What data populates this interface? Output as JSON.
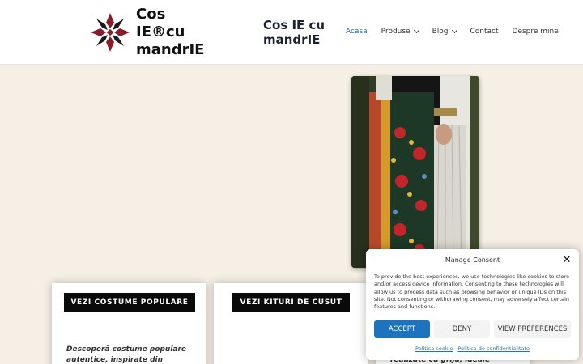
{
  "header": {
    "logo_text": "Cos IE®cu mandrIE",
    "logo_line1": "Cos IE®cu",
    "logo_line2": "mandrIE",
    "site_title_line1": "Cos IE cu",
    "site_title_line2": "mandrIE",
    "nav": [
      {
        "label": "Acasa",
        "active": true,
        "dropdown": false
      },
      {
        "label": "Produse",
        "active": false,
        "dropdown": true
      },
      {
        "label": "Blog",
        "active": false,
        "dropdown": true
      },
      {
        "label": "Contact",
        "active": false,
        "dropdown": false
      },
      {
        "label": "Despre mine",
        "active": false,
        "dropdown": false
      }
    ]
  },
  "cards": [
    {
      "button": "VEZI COSTUME POPULARE",
      "desc": "Descoperă costume populare autentice, inspirate din tradiţiile"
    },
    {
      "button": "VEZI KITURI DE CUSUT",
      "desc": ""
    },
    {
      "button": "",
      "desc": "realizate cu grijă, ideale pentru"
    }
  ],
  "consent": {
    "title": "Manage Consent",
    "body": "To provide the best experiences, we use technologies like cookies to store and/or access device information. Consenting to these technologies will allow us to process data such as browsing behavior or unique IDs on this site. Not consenting or withdrawing consent, may adversely affect certain features and functions.",
    "accept": "ACCEPT",
    "deny": "DENY",
    "preferences": "VIEW PREFERENCES",
    "link_cookie": "Politica cookie",
    "link_privacy": "Politica de confidentialitate"
  },
  "colors": {
    "accent": "#1e73be",
    "nav_active": "#1d67b5",
    "page_bg": "#f5efe6"
  }
}
